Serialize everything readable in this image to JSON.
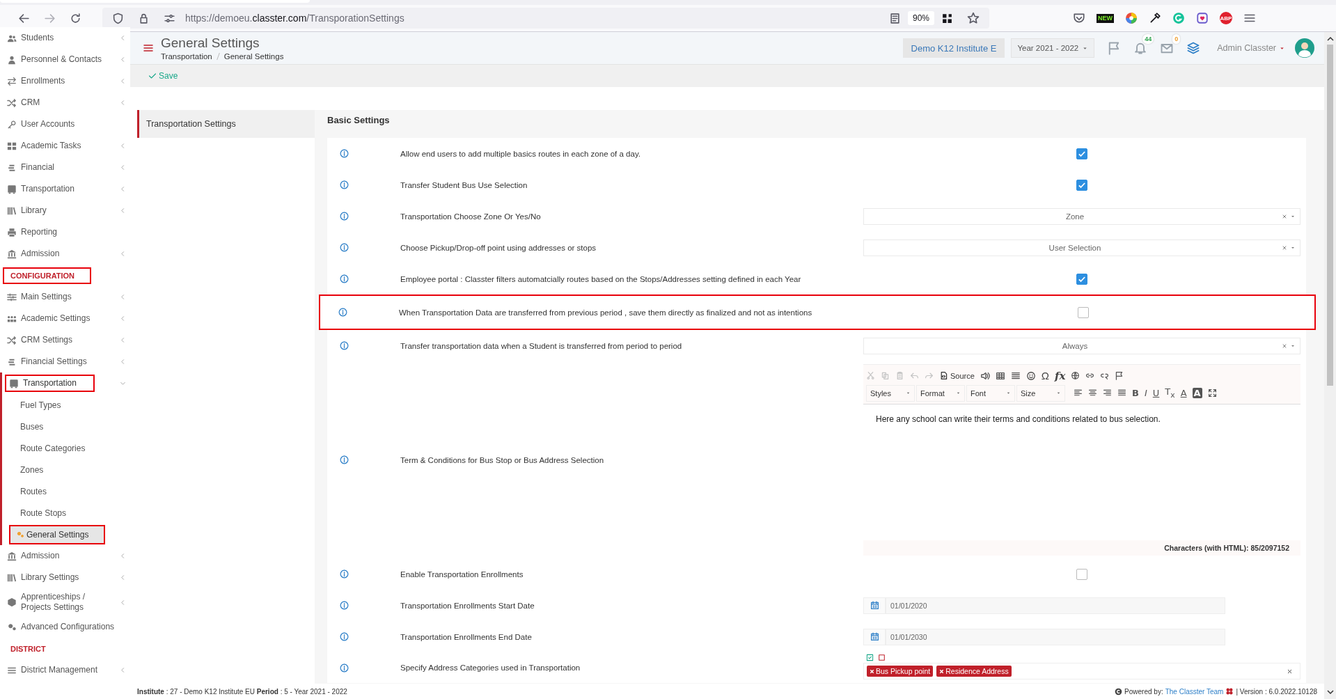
{
  "browser": {
    "url_prefix": "https://demoeu.",
    "url_domain": "classter.com",
    "url_path": "/TransporationSettings",
    "zoom": "90%",
    "extension_badge": "NEW",
    "adblock_label": "ABP"
  },
  "sidebar": {
    "items": [
      {
        "kind": "item",
        "label": "Students",
        "has_submenu": true,
        "expanded": false,
        "outlined": false
      },
      {
        "kind": "item",
        "label": "Personnel & Contacts",
        "has_submenu": true,
        "expanded": false,
        "outlined": false
      },
      {
        "kind": "item",
        "label": "Enrollments",
        "has_submenu": true,
        "expanded": false,
        "outlined": false
      },
      {
        "kind": "item",
        "label": "CRM",
        "has_submenu": true,
        "expanded": false,
        "outlined": false
      },
      {
        "kind": "item",
        "label": "User Accounts",
        "has_submenu": false,
        "outlined": false
      },
      {
        "kind": "item",
        "label": "Academic Tasks",
        "has_submenu": true,
        "expanded": false,
        "outlined": false
      },
      {
        "kind": "item",
        "label": "Financial",
        "has_submenu": true,
        "expanded": false,
        "outlined": false
      },
      {
        "kind": "item",
        "label": "Transportation",
        "has_submenu": true,
        "expanded": false,
        "outlined": false
      },
      {
        "kind": "item",
        "label": "Library",
        "has_submenu": true,
        "expanded": false,
        "outlined": false
      },
      {
        "kind": "item",
        "label": "Reporting",
        "has_submenu": false,
        "outlined": false
      },
      {
        "kind": "item",
        "label": "Admission",
        "has_submenu": true,
        "expanded": false,
        "outlined": false
      },
      {
        "kind": "header",
        "label": "CONFIGURATION",
        "outlined": true
      },
      {
        "kind": "item",
        "label": "Main Settings",
        "has_submenu": true,
        "expanded": false,
        "outlined": false
      },
      {
        "kind": "item",
        "label": "Academic Settings",
        "has_submenu": true,
        "expanded": false,
        "outlined": false
      },
      {
        "kind": "item",
        "label": "CRM Settings",
        "has_submenu": true,
        "expanded": false,
        "outlined": false
      },
      {
        "kind": "item",
        "label": "Financial Settings",
        "has_submenu": true,
        "expanded": false,
        "outlined": false
      },
      {
        "kind": "item",
        "label": "Transportation",
        "has_submenu": true,
        "expanded": true,
        "outlined": true,
        "children": [
          {
            "label": "Fuel Types",
            "selected": false,
            "outlined": false
          },
          {
            "label": "Buses",
            "selected": false,
            "outlined": false
          },
          {
            "label": "Route Categories",
            "selected": false,
            "outlined": false
          },
          {
            "label": "Zones",
            "selected": false,
            "outlined": false
          },
          {
            "label": "Routes",
            "selected": false,
            "outlined": false
          },
          {
            "label": "Route Stops",
            "selected": false,
            "outlined": false
          },
          {
            "label": "General Settings",
            "selected": true,
            "outlined": true
          }
        ]
      },
      {
        "kind": "item",
        "label": "Admission",
        "has_submenu": true,
        "expanded": false,
        "outlined": false
      },
      {
        "kind": "item",
        "label": "Library Settings",
        "has_submenu": true,
        "expanded": false,
        "outlined": false
      },
      {
        "kind": "item",
        "label": "Apprenticeships / Projects Settings",
        "has_submenu": true,
        "expanded": false,
        "outlined": false
      },
      {
        "kind": "item",
        "label": "Advanced Configurations",
        "has_submenu": false,
        "outlined": false
      },
      {
        "kind": "header",
        "label": "DISTRICT",
        "outlined": false
      },
      {
        "kind": "item",
        "label": "District Management",
        "has_submenu": true,
        "expanded": false,
        "outlined": false
      }
    ]
  },
  "header": {
    "title": "General Settings",
    "breadcrumb": [
      "Transportation",
      "General Settings"
    ],
    "institute": "Demo K12 Institute E",
    "year": "Year 2021 - 2022",
    "notifications": "44",
    "messages": "0",
    "user": "Admin Classter"
  },
  "actions": {
    "save": "Save"
  },
  "settings_nav": [
    {
      "label": "Transportation Settings",
      "selected": true
    }
  ],
  "section_title": "Basic Settings",
  "rows": [
    {
      "kind": "checkbox",
      "label": "Allow end users to add multiple basics routes in each zone of a day.",
      "checked": true,
      "outlined": false
    },
    {
      "kind": "checkbox",
      "label": "Transfer Student Bus Use Selection",
      "checked": true,
      "outlined": false
    },
    {
      "kind": "select",
      "label": "Transportation Choose Zone Or Yes/No",
      "value": "Zone",
      "outlined": false
    },
    {
      "kind": "select",
      "label": "Choose Pickup/Drop-off point using addresses or stops",
      "value": "User Selection",
      "outlined": false
    },
    {
      "kind": "checkbox",
      "label": "Employee portal : Classter filters automatcially routes based on the Stops/Addresses setting defined in each Year",
      "checked": true,
      "outlined": false
    },
    {
      "kind": "checkbox",
      "label": "When Transportation Data are transferred from previous period , save them directly as finalized and not as intentions",
      "checked": false,
      "outlined": true
    },
    {
      "kind": "select",
      "label": "Transfer transportation data when a Student is transferred from period to period",
      "value": "Always",
      "outlined": false
    },
    {
      "kind": "editor",
      "label": "Term & Conditions for Bus Stop or Bus Address Selection",
      "source_label": "Source",
      "symbols": [
        "Ω",
        "fx"
      ],
      "dropdowns": [
        "Styles",
        "Format",
        "Font",
        "Size"
      ],
      "format_buttons": [
        "B",
        "I",
        "U",
        "T$_{x}$",
        "A",
        "A"
      ],
      "content": "Here any school can write their terms and conditions related to bus selection.",
      "counter": "Characters (with HTML): 85/2097152",
      "outlined": false
    },
    {
      "kind": "checkbox",
      "label": "Enable Transportation Enrollments",
      "checked": false,
      "outlined": false
    },
    {
      "kind": "date",
      "label": "Transportation Enrollments Start Date",
      "value": "01/01/2020",
      "outlined": false
    },
    {
      "kind": "date",
      "label": "Transportation Enrollments End Date",
      "value": "01/01/2030",
      "outlined": false
    },
    {
      "kind": "tags",
      "label": "Specify Address Categories used in Transportation",
      "tags": [
        "Bus Pickup point",
        "Residence Address"
      ],
      "outlined": false
    }
  ],
  "footer": {
    "context": "**Institute** : 27 - Demo K12 Institute EU **Period** : 5 - Year 2021 - 2022",
    "powered_by": "Powered by:",
    "team_link": "The Classter Team",
    "version": "| Version : 6.0.2022.10128"
  }
}
